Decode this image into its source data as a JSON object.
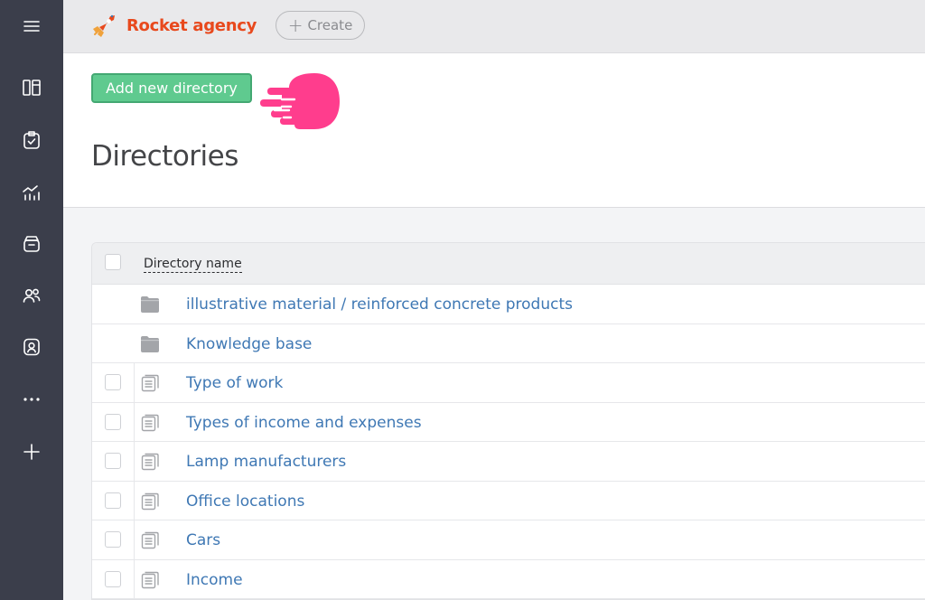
{
  "sidebar": {
    "items": [
      {
        "name": "menu-icon"
      },
      {
        "name": "feed-icon"
      },
      {
        "name": "tasks-icon"
      },
      {
        "name": "analytics-icon"
      },
      {
        "name": "crm-icon"
      },
      {
        "name": "employees-icon"
      },
      {
        "name": "contacts-icon"
      },
      {
        "name": "more-icon"
      },
      {
        "name": "add-icon"
      }
    ]
  },
  "topbar": {
    "brand": "Rocket agency",
    "create_label": "Create",
    "brand_color": "#e8491d"
  },
  "header": {
    "add_button_label": "Add new directory",
    "title": "Directories",
    "accent_color": "#5fca8f",
    "pointer_color": "#ff3d8d"
  },
  "table": {
    "column_header": "Directory name",
    "rows": [
      {
        "label": "illustrative material / reinforced concrete products",
        "icon": "folder-icon",
        "checkbox": false
      },
      {
        "label": "Knowledge base",
        "icon": "folder-icon",
        "checkbox": false
      },
      {
        "label": "Type of work",
        "icon": "list-icon",
        "checkbox": true
      },
      {
        "label": "Types of income and expenses",
        "icon": "list-icon",
        "checkbox": true
      },
      {
        "label": "Lamp manufacturers",
        "icon": "list-icon",
        "checkbox": true
      },
      {
        "label": "Office locations",
        "icon": "list-icon",
        "checkbox": true
      },
      {
        "label": "Cars",
        "icon": "list-icon",
        "checkbox": true
      },
      {
        "label": "Income",
        "icon": "list-icon",
        "checkbox": true
      }
    ]
  }
}
